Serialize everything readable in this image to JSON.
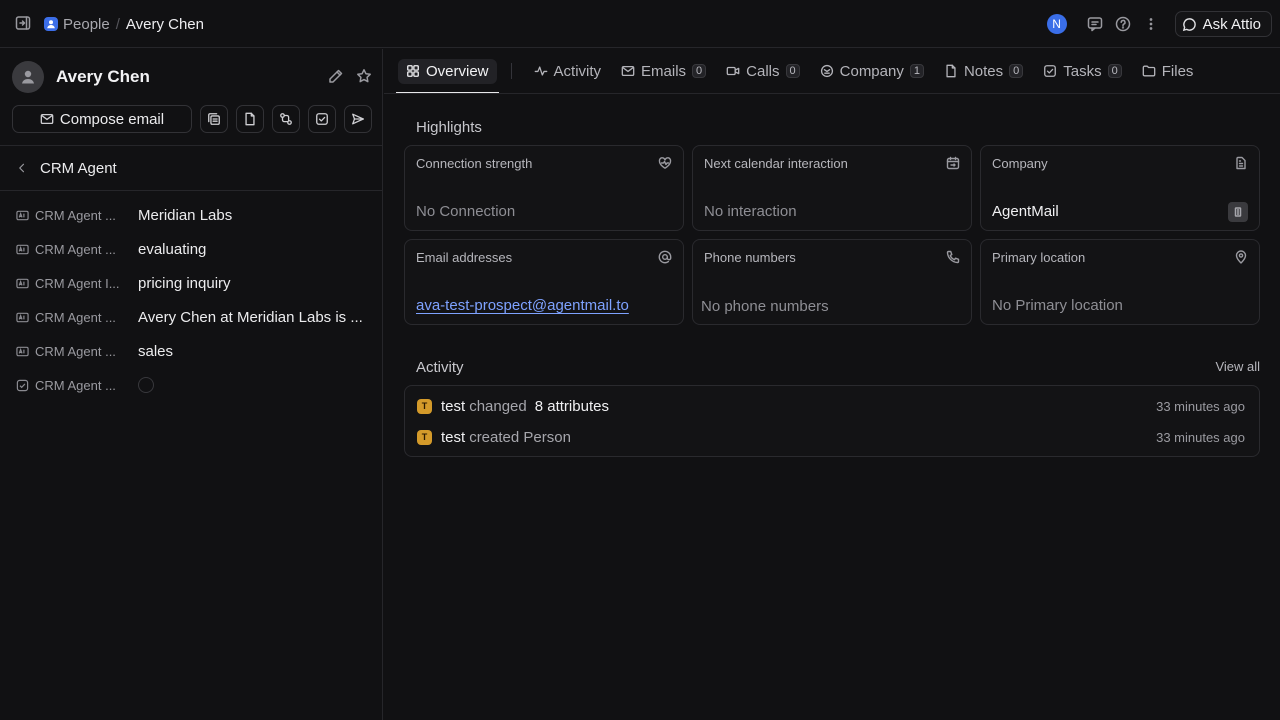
{
  "topbar": {
    "breadcrumb_object": "People",
    "breadcrumb_separator": "/",
    "breadcrumb_record": "Avery Chen",
    "user_avatar_letter": "N",
    "ask_button": "Ask Attio"
  },
  "record": {
    "name": "Avery Chen",
    "compose_button": "Compose email"
  },
  "crm_section": {
    "title": "CRM Agent",
    "attributes": [
      {
        "label": "CRM Agent ...",
        "value": "Meridian Labs",
        "icon": "text-attribute-icon"
      },
      {
        "label": "CRM Agent ...",
        "value": "evaluating",
        "icon": "text-attribute-icon"
      },
      {
        "label": "CRM Agent I...",
        "value": "pricing inquiry",
        "icon": "text-attribute-icon"
      },
      {
        "label": "CRM Agent ...",
        "value": "Avery Chen at Meridian Labs is ...",
        "icon": "text-attribute-icon"
      },
      {
        "label": "CRM Agent ...",
        "value": "sales",
        "icon": "text-attribute-icon"
      },
      {
        "label": "CRM Agent ...",
        "value": "",
        "icon": "checkbox-attribute-icon"
      }
    ]
  },
  "tabs": [
    {
      "label": "Overview",
      "count": null,
      "icon": "grid-icon",
      "active": true
    },
    {
      "label": "Activity",
      "count": null,
      "icon": "pulse-icon"
    },
    {
      "label": "Emails",
      "count": "0",
      "icon": "mail-icon"
    },
    {
      "label": "Calls",
      "count": "0",
      "icon": "video-icon"
    },
    {
      "label": "Company",
      "count": "1",
      "icon": "company-icon"
    },
    {
      "label": "Notes",
      "count": "0",
      "icon": "note-icon"
    },
    {
      "label": "Tasks",
      "count": "0",
      "icon": "task-icon"
    },
    {
      "label": "Files",
      "count": null,
      "icon": "folder-icon"
    }
  ],
  "highlights": {
    "title": "Highlights",
    "cards": [
      {
        "title": "Connection strength",
        "value": "No Connection",
        "icon": "heart-pulse-icon"
      },
      {
        "title": "Next calendar interaction",
        "value": "No interaction",
        "icon": "calendar-icon"
      },
      {
        "title": "Company",
        "value": "AgentMail",
        "icon": "building-icon"
      },
      {
        "title": "Email addresses",
        "value": "ava-test-prospect@agentmail.to",
        "icon": "at-icon"
      },
      {
        "title": "Phone numbers",
        "value": "No phone numbers",
        "icon": "phone-icon"
      },
      {
        "title": "Primary location",
        "value": "No Primary location",
        "icon": "location-pin-icon"
      }
    ]
  },
  "activity": {
    "title": "Activity",
    "view_all": "View all",
    "items": [
      {
        "avatar": "T",
        "actor": "test",
        "verb": "changed",
        "object": "8 attributes",
        "time": "33 minutes ago"
      },
      {
        "avatar": "T",
        "actor": "test",
        "verb": "created Person",
        "object": "",
        "time": "33 minutes ago"
      }
    ]
  }
}
